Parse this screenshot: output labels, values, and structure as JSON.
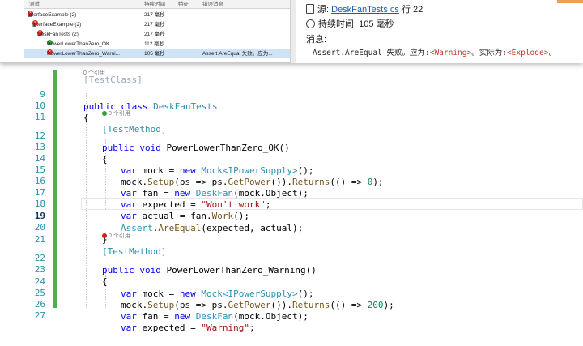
{
  "test_explorer": {
    "columns": [
      "测试",
      "持续时间",
      "特征",
      "错误消息"
    ],
    "rows": [
      {
        "name": "InterfaceExample (2)",
        "duration": "217 毫秒",
        "status": "fail",
        "error": ""
      },
      {
        "name": "InterfaceExample (2)",
        "duration": "217 毫秒",
        "status": "fail",
        "error": ""
      },
      {
        "name": "DeskFanTests (2)",
        "duration": "217 毫秒",
        "status": "fail",
        "error": ""
      },
      {
        "name": "PowerLowerThanZero_OK",
        "duration": "112 毫秒",
        "status": "pass",
        "error": ""
      },
      {
        "name": "PowerLowerThanZero_Warni...",
        "duration": "105 毫秒",
        "status": "fail",
        "error": "Assert.AreEqual 失败。应为..."
      }
    ]
  },
  "details": {
    "source_label": "源:",
    "source_file": "DeskFanTests.cs",
    "source_line": "行 22",
    "duration_label": "持续时间:",
    "duration_value": "105 毫秒",
    "message_label": "消息:",
    "message_prefix": "Assert.AreEqual 失败。应为:",
    "expected": "<Warning>",
    "message_mid": "。实际为:",
    "actual": "<Explode>",
    "message_suffix": "。"
  },
  "editor": {
    "line_numbers": [
      "9",
      "10",
      "11",
      "12",
      "13",
      "14",
      "15",
      "16",
      "17",
      "18",
      "19",
      "20",
      "21",
      "22",
      "23",
      "24",
      "25",
      "26",
      "27"
    ],
    "current_line": "19",
    "hints": {
      "class_refs": "0 个引用",
      "method_ok_refs": "0 个引用",
      "method_warning_refs": "0 个引用"
    },
    "partial_top": "[TestClass]",
    "code": {
      "l9_kw": "public class ",
      "l9_ty": "DeskFanTests",
      "l10": "{",
      "l11": "[TestMethod]",
      "l12_kw": "public void ",
      "l12_name": "PowerLowerThanZero_OK()",
      "l13": "{",
      "l14_a": "var ",
      "l14_b": "mock = ",
      "l14_c": "new ",
      "l14_d": "Mock<IPowerSupply>",
      "l14_e": "();",
      "l15_a": "mock.",
      "l15_b": "Setup",
      "l15_c": "(ps => ps.",
      "l15_d": "GetPower",
      "l15_e": "()).",
      "l15_f": "Returns",
      "l15_g": "(() => ",
      "l15_h": "0",
      "l15_i": ");",
      "l16_a": "var ",
      "l16_b": "fan = ",
      "l16_c": "new ",
      "l16_d": "DeskFan",
      "l16_e": "(mock.Object);",
      "l17_a": "var ",
      "l17_b": "expected = ",
      "l17_c": "\"Won't work\"",
      "l17_d": ";",
      "l18_a": "var ",
      "l18_b": "actual = fan.",
      "l18_c": "Work",
      "l18_d": "();",
      "l19_a": "Assert",
      "l19_b": ".",
      "l19_c": "AreEqual",
      "l19_d": "(expected, actual);",
      "l20": "}",
      "l21": "[TestMethod]",
      "l22_kw": "public void ",
      "l22_name": "PowerLowerThanZero_Warning()",
      "l23": "{",
      "l24_a": "var ",
      "l24_b": "mock = ",
      "l24_c": "new ",
      "l24_d": "Mock<IPowerSupply>",
      "l24_e": "();",
      "l25_a": "mock.",
      "l25_b": "Setup",
      "l25_c": "(ps => ps.",
      "l25_d": "GetPower",
      "l25_e": "()).",
      "l25_f": "Returns",
      "l25_g": "(() => ",
      "l25_h": "200",
      "l25_i": ");",
      "l26_a": "var ",
      "l26_b": "fan = ",
      "l26_c": "new ",
      "l26_d": "DeskFan",
      "l26_e": "(mock.Object);",
      "l27_a": "var ",
      "l27_b": "expected = ",
      "l27_c": "\"Warning\"",
      "l27_d": ";"
    }
  },
  "colors": {
    "keyword": "#0000ff",
    "type": "#2b91af",
    "string": "#a31515",
    "fail": "#e0201b",
    "pass": "#2e9e3e",
    "line_number": "#2b91af"
  }
}
